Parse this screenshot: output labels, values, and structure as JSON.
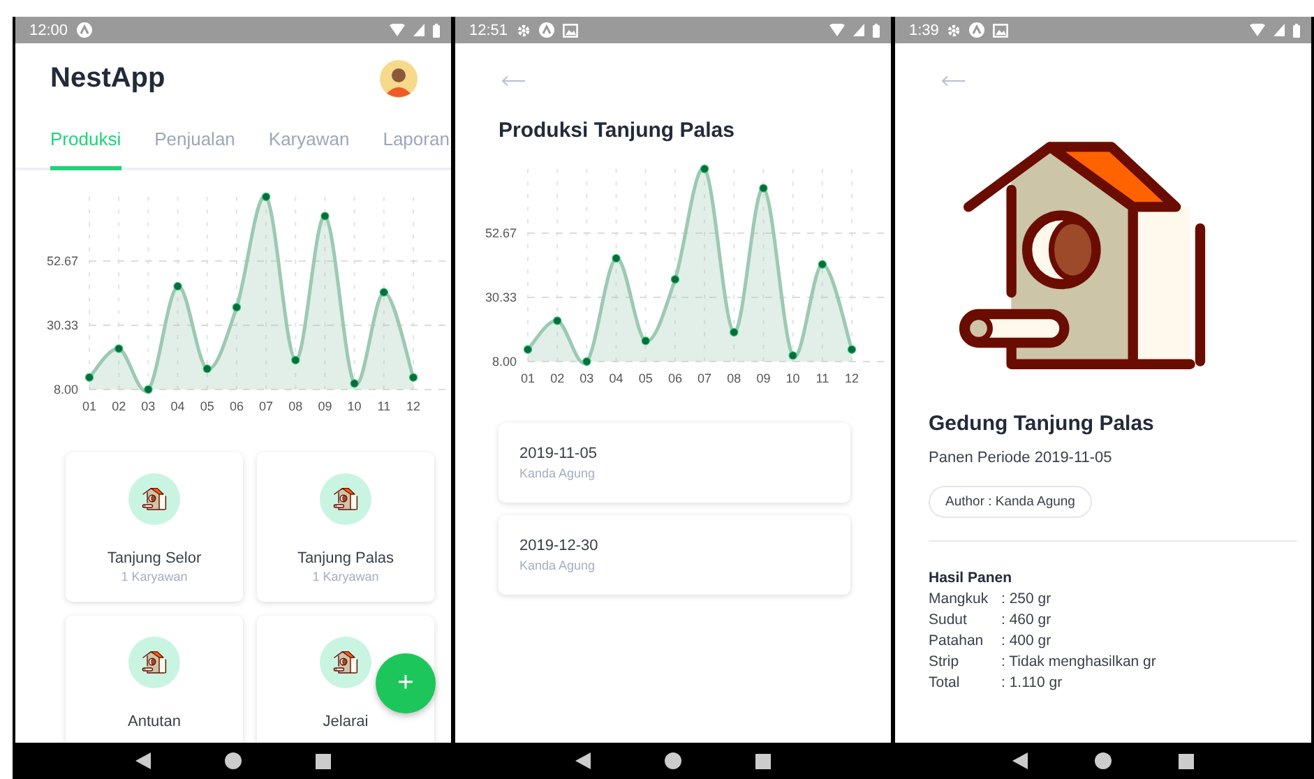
{
  "home": {
    "status_bar": {
      "time": "12:00"
    },
    "app_title": "NestApp",
    "tabs": [
      {
        "label": "Produksi",
        "selected": true
      },
      {
        "label": "Penjualan",
        "selected": false
      },
      {
        "label": "Karyawan",
        "selected": false
      },
      {
        "label": "Laporan",
        "selected": false
      }
    ],
    "chart_data": {
      "type": "area",
      "grid": true,
      "categories": [
        "01",
        "02",
        "03",
        "04",
        "05",
        "06",
        "07",
        "08",
        "09",
        "10",
        "11",
        "12"
      ],
      "series": [
        {
          "color": "#9cc9b3",
          "values": [
            12.2,
            22.2,
            8,
            43.9,
            15.2,
            36.6,
            75,
            18.2,
            68.3,
            10.1,
            41.8,
            12.2
          ]
        }
      ],
      "ylim": [
        8,
        75
      ],
      "yticks": [
        {
          "value": 8,
          "label": "8.00"
        },
        {
          "value": 30.33,
          "label": "30.33"
        },
        {
          "value": 52.67,
          "label": "52.67"
        }
      ]
    },
    "locations": [
      {
        "name": "Tanjung Selor",
        "subtitle": "1 Karyawan"
      },
      {
        "name": "Tanjung Palas",
        "subtitle": "1 Karyawan"
      },
      {
        "name": "Antutan"
      },
      {
        "name": "Jelarai"
      }
    ],
    "fab": "+"
  },
  "production": {
    "status_bar": {
      "time": "12:51"
    },
    "title": "Produksi Tanjung Palas",
    "chart_data": {
      "type": "area",
      "grid": true,
      "categories": [
        "01",
        "02",
        "03",
        "04",
        "05",
        "06",
        "07",
        "08",
        "09",
        "10",
        "11",
        "12"
      ],
      "series": [
        {
          "color": "#9cc9b3",
          "values": [
            12.2,
            22.2,
            8,
            43.9,
            15.2,
            36.6,
            75,
            18.2,
            68.3,
            10.1,
            41.8,
            12.2
          ]
        }
      ],
      "ylim": [
        8,
        75
      ],
      "yticks": [
        {
          "value": 8,
          "label": "8.00"
        },
        {
          "value": 30.33,
          "label": "30.33"
        },
        {
          "value": 52.67,
          "label": "52.67"
        }
      ]
    },
    "entries": [
      {
        "date": "2019-11-05",
        "author": "Kanda Agung"
      },
      {
        "date": "2019-12-30",
        "author": "Kanda Agung"
      }
    ]
  },
  "detail": {
    "status_bar": {
      "time": "1:39"
    },
    "title": "Gedung Tanjung Palas",
    "period": "Panen Periode 2019-11-05",
    "author_chip": "Author : Kanda Agung",
    "results_heading": "Hasil Panen",
    "results": [
      {
        "label": "Mangkuk",
        "value": ": 250 gr"
      },
      {
        "label": "Sudut",
        "value": ": 460 gr"
      },
      {
        "label": "Patahan",
        "value": ": 400 gr"
      },
      {
        "label": "Strip",
        "value": ": Tidak menghasilkan gr"
      },
      {
        "label": "Total",
        "value": ": 1.110 gr"
      }
    ]
  }
}
